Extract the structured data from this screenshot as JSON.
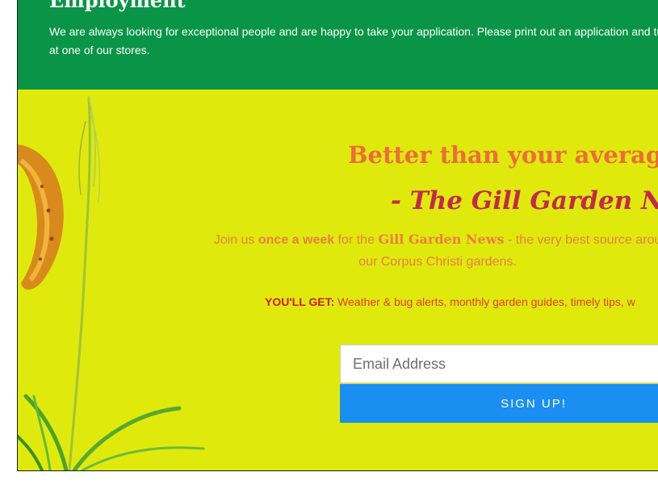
{
  "employment": {
    "title": "Employment",
    "text": "We are always looking for exceptional people and are happy to take your application. Please print out an application and turn in at one of our stores."
  },
  "newsletter": {
    "headline": "Better than your average e",
    "script_title": "- The Gill Garden News",
    "blurb": {
      "part1": "Join us ",
      "bold1": "once a week",
      "part2": " for the ",
      "bold2": "Gill Garden News",
      "part3": " - the very best source arou",
      "part4": "our Corpus Christi gardens."
    },
    "benefits_label": "YOU'LL GET:",
    "benefits_text": " Weather & bug alerts, monthly garden guides, timely tips, w",
    "email_placeholder": "Email Address",
    "signup_label": "SIGN UP!"
  },
  "colors": {
    "employment_bg": "#0a9447",
    "newsletter_bg": "#dfea0c",
    "headline": "#ee6b3c",
    "script_title": "#c5284c",
    "button": "#1b8ef2"
  },
  "icons": [
    "dried-seed-pod-illustration",
    "grass-stalk-illustration"
  ]
}
